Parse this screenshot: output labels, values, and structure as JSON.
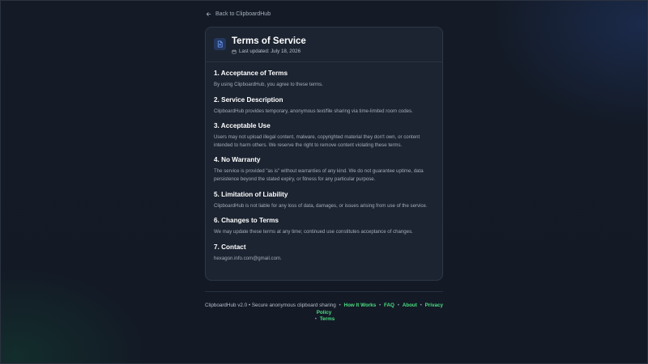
{
  "back_link": {
    "label": "Back to ClipboardHub"
  },
  "header": {
    "title": "Terms of Service",
    "last_updated": "Last updated: July 18, 2026"
  },
  "sections": [
    {
      "title": "1. Acceptance of Terms",
      "text": "By using ClipboardHub, you agree to these terms."
    },
    {
      "title": "2. Service Description",
      "text": "ClipboardHub provides temporary, anonymous text/file sharing via time-limited room codes."
    },
    {
      "title": "3. Acceptable Use",
      "text": "Users may not upload illegal content, malware, copyrighted material they don't own, or content intended to harm others. We reserve the right to remove content violating these terms."
    },
    {
      "title": "4. No Warranty",
      "text": "The service is provided \"as is\" without warranties of any kind. We do not guarantee uptime, data persistence beyond the stated expiry, or fitness for any particular purpose."
    },
    {
      "title": "5. Limitation of Liability",
      "text": "ClipboardHub is not liable for any loss of data, damages, or issues arising from use of the service."
    },
    {
      "title": "6. Changes to Terms",
      "text": "We may update these terms at any time; continued use constitutes acceptance of changes."
    },
    {
      "title": "7. Contact",
      "text": "hexagon.info.com@gmail.com."
    }
  ],
  "footer": {
    "text": "ClipboardHub v2.0 • Secure anonymous clipboard sharing",
    "separator": "•",
    "links": [
      "How It Works",
      "FAQ",
      "About",
      "Privacy Policy",
      "Terms"
    ]
  },
  "colors": {
    "accent_link": "#4ade80",
    "card_bg": "#1c2431",
    "page_bg": "#131a26",
    "icon_bg": "#24375d",
    "icon_fg": "#6ea0ff"
  },
  "icons": {
    "back": "arrow-left-icon",
    "document": "document-icon",
    "calendar": "calendar-icon"
  }
}
